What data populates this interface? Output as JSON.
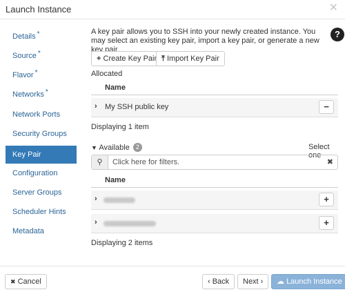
{
  "header": {
    "title": "Launch Instance",
    "close_glyph": "✕"
  },
  "sidebar": {
    "items": [
      {
        "label": "Details",
        "required": "*"
      },
      {
        "label": "Source",
        "required": "*"
      },
      {
        "label": "Flavor",
        "required": "*"
      },
      {
        "label": "Networks",
        "required": "*"
      },
      {
        "label": "Network Ports",
        "required": ""
      },
      {
        "label": "Security Groups",
        "required": ""
      },
      {
        "label": "Key Pair",
        "required": "",
        "active": true
      },
      {
        "label": "Configuration",
        "required": ""
      },
      {
        "label": "Server Groups",
        "required": ""
      },
      {
        "label": "Scheduler Hints",
        "required": ""
      },
      {
        "label": "Metadata",
        "required": ""
      }
    ]
  },
  "main": {
    "description": "A key pair allows you to SSH into your newly created instance. You may select an existing key pair, import a key pair, or generate a new key pair.",
    "help_icon": "?",
    "create_label": "Create Key Pair",
    "create_glyph": "+",
    "import_label": "Import Key Pair",
    "import_glyph": "⤒",
    "allocated": {
      "label": "Allocated",
      "column_name": "Name",
      "rows": [
        {
          "name": "My SSH public key",
          "action": "−"
        }
      ],
      "count_text": "Displaying 1 item"
    },
    "available": {
      "label": "Available",
      "count_badge": "2",
      "select_hint": "Select one",
      "filter_placeholder": "Click here for filters.",
      "filter_clear": "✖",
      "column_name": "Name",
      "rows": [
        {
          "name": "",
          "action": "+"
        },
        {
          "name": "",
          "action": "+"
        }
      ],
      "count_text": "Displaying 2 items"
    }
  },
  "footer": {
    "cancel_label": "Cancel",
    "cancel_glyph": "✖",
    "back_label": "‹ Back",
    "next_label": "Next ›",
    "launch_label": "Launch Instance",
    "launch_glyph": "☁"
  },
  "colors": {
    "accent": "#337ab7",
    "link": "#2a6496",
    "launch_disabled": "#8bb3d9"
  }
}
